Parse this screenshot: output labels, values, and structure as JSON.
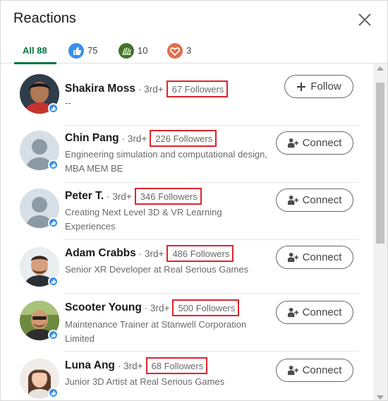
{
  "modal": {
    "title": "Reactions"
  },
  "tabs": [
    {
      "label": "All 88",
      "icon": "all"
    },
    {
      "label": "75",
      "icon": "like-icon",
      "color": "#378fe9"
    },
    {
      "label": "10",
      "icon": "celebrate-icon",
      "color": "#44712e"
    },
    {
      "label": "3",
      "icon": "love-icon",
      "color": "#df704d"
    }
  ],
  "reactors": [
    {
      "name": "Shakira Moss",
      "degree": "· 3rd+",
      "followers": "67 Followers",
      "headline": "--",
      "action": "Follow"
    },
    {
      "name": "Chin Pang",
      "degree": "· 3rd+",
      "followers": "226 Followers",
      "headline": "Engineering simulation and computational design, MBA MEM BE",
      "action": "Connect"
    },
    {
      "name": "Peter T.",
      "degree": "· 3rd+",
      "followers": "346 Followers",
      "headline": "Creating Next Level 3D & VR Learning Experiences",
      "action": "Connect"
    },
    {
      "name": "Adam Crabbs",
      "degree": "· 3rd+",
      "followers": "486 Followers",
      "headline": "Senior XR Developer at Real Serious Games",
      "action": "Connect"
    },
    {
      "name": "Scooter Young",
      "degree": "· 3rd+",
      "followers": "500 Followers",
      "headline": "Maintenance Trainer at Stanwell Corporation Limited",
      "action": "Connect"
    },
    {
      "name": "Luna Ang",
      "degree": "· 3rd+",
      "followers": "68 Followers",
      "headline": "Junior 3D Artist at Real Serious Games",
      "action": "Connect"
    }
  ],
  "colors": {
    "accent": "#057642",
    "highlight_box": "#e0232e",
    "like_blue": "#378fe9"
  }
}
